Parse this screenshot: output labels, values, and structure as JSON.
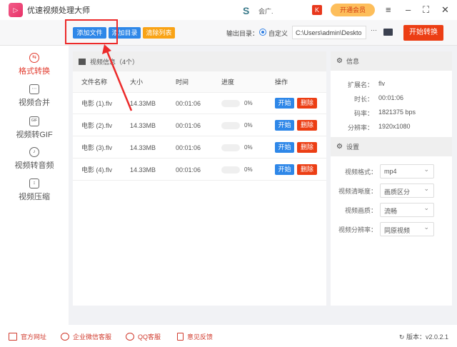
{
  "app": {
    "title": "优速视频处理大师",
    "brand_text": "会广.",
    "vip_label": "开通会员"
  },
  "toolbar": {
    "add_file": "添加文件",
    "add_dir": "添加目录",
    "clear_list": "清除列表",
    "output_label": "输出目录：",
    "custom_label": "自定义",
    "output_path": "C:\\Users\\admin\\Deskto",
    "more": "···",
    "start_all": "开始转换"
  },
  "sidebar": {
    "items": [
      {
        "label": "格式转换",
        "icon": "⇆"
      },
      {
        "label": "视频合并",
        "icon": "⋯"
      },
      {
        "label": "视频转GIF",
        "icon": "GIF"
      },
      {
        "label": "视频转音频",
        "icon": "♪"
      },
      {
        "label": "视频压缩",
        "icon": "↕"
      }
    ]
  },
  "list": {
    "title": "视频信息（4个）",
    "headers": [
      "文件名称",
      "大小",
      "时间",
      "进度",
      "操作"
    ],
    "rows": [
      {
        "name": "电影 (1).flv",
        "size": "14.33MB",
        "time": "00:01:06",
        "progress": "0%",
        "start": "开始",
        "delete": "删除"
      },
      {
        "name": "电影 (2).flv",
        "size": "14.33MB",
        "time": "00:01:06",
        "progress": "0%",
        "start": "开始",
        "delete": "删除"
      },
      {
        "name": "电影 (3).flv",
        "size": "14.33MB",
        "time": "00:01:06",
        "progress": "0%",
        "start": "开始",
        "delete": "删除"
      },
      {
        "name": "电影 (4).flv",
        "size": "14.33MB",
        "time": "00:01:06",
        "progress": "0%",
        "start": "开始",
        "delete": "删除"
      }
    ]
  },
  "info": {
    "title": "信息",
    "items": [
      {
        "k": "扩展名：",
        "v": "flv"
      },
      {
        "k": "时长：",
        "v": "00:01:06"
      },
      {
        "k": "码率：",
        "v": "1821375 bps"
      },
      {
        "k": "分辨率：",
        "v": "1920x1080"
      }
    ]
  },
  "settings": {
    "title": "设置",
    "items": [
      {
        "k": "视频格式：",
        "v": "mp4"
      },
      {
        "k": "视频清晰度：",
        "v": "画质区分"
      },
      {
        "k": "视频画质：",
        "v": "流畅"
      },
      {
        "k": "视频分辨率：",
        "v": "同原视频"
      }
    ]
  },
  "footer": {
    "links": [
      "官方网址",
      "企业微信客服",
      "QQ客服",
      "意见反馈"
    ],
    "version": "版本：v2.0.2.1"
  }
}
